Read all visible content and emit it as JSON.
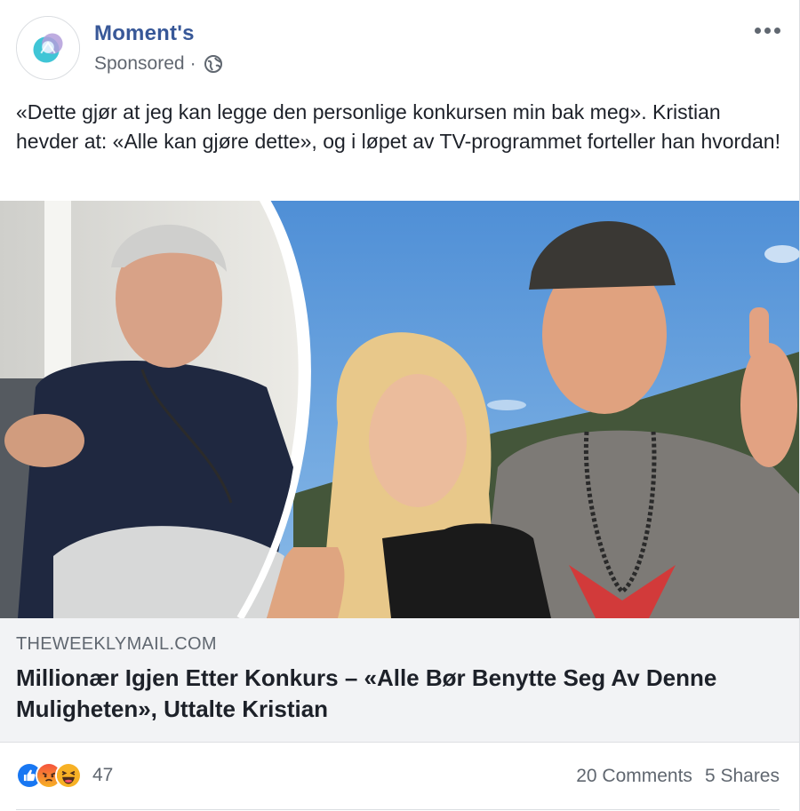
{
  "post": {
    "page_name": "Moment's",
    "sponsored_label": "Sponsored",
    "separator": "·",
    "caption": "«Dette gjør at jeg kan legge den personlige konkursen min bak meg». Kristian hevder at: «Alle kan gjøre dette», og i løpet av TV-programmet forteller han hvordan!"
  },
  "link": {
    "domain": "THEWEEKLYMAIL.COM",
    "headline": "Millionær Igjen Etter Konkurs – «Alle Bør Benytte Seg Av Denne Muligheten», Uttalte Kristian"
  },
  "footer": {
    "reaction_count": "47",
    "comments": "20 Comments",
    "shares": "5 Shares"
  },
  "icons": {
    "avatar": "moments-logo-icon",
    "audience": "globe-icon",
    "more": "more-options-icon",
    "reactions": [
      "like-icon",
      "angry-icon",
      "haha-icon"
    ]
  },
  "colors": {
    "page_name": "#385898",
    "meta_text": "#616770",
    "link_background": "#f2f3f5",
    "like_blue": "#1877f2",
    "angry_red": "#f5533d",
    "haha_yellow": "#f7b125"
  }
}
